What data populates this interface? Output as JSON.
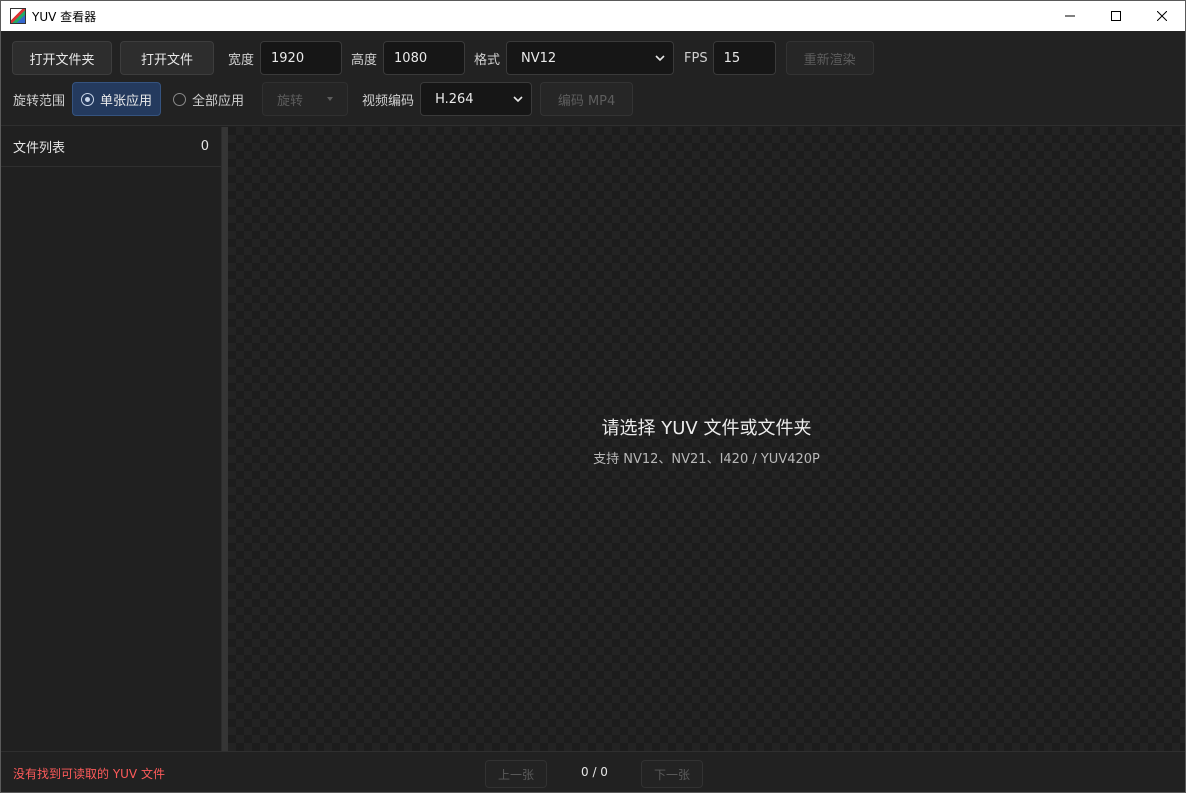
{
  "window": {
    "title": "YUV 查看器"
  },
  "toolbar": {
    "open_folder": "打开文件夹",
    "open_file": "打开文件",
    "width_label": "宽度",
    "width_value": "1920",
    "height_label": "高度",
    "height_value": "1080",
    "format_label": "格式",
    "format_value": "NV12",
    "fps_label": "FPS",
    "fps_value": "15",
    "rerender": "重新渲染",
    "rotate_scope_label": "旋转范围",
    "scope_single": "单张应用",
    "scope_all": "全部应用",
    "scope_selected": "single",
    "rotate": "旋转",
    "codec_label": "视频编码",
    "codec_value": "H.264",
    "encode": "编码 MP4"
  },
  "sidebar": {
    "title": "文件列表",
    "count": "0"
  },
  "viewer": {
    "empty_title": "请选择 YUV 文件或文件夹",
    "empty_sub": "支持 NV12、NV21、I420 / YUV420P"
  },
  "status": {
    "message": "没有找到可读取的 YUV 文件",
    "message_color": "#ff5b5b",
    "prev": "上一张",
    "next": "下一张",
    "page": "0 / 0"
  },
  "colors": {
    "accent": "#243a5e",
    "background": "#202020"
  }
}
